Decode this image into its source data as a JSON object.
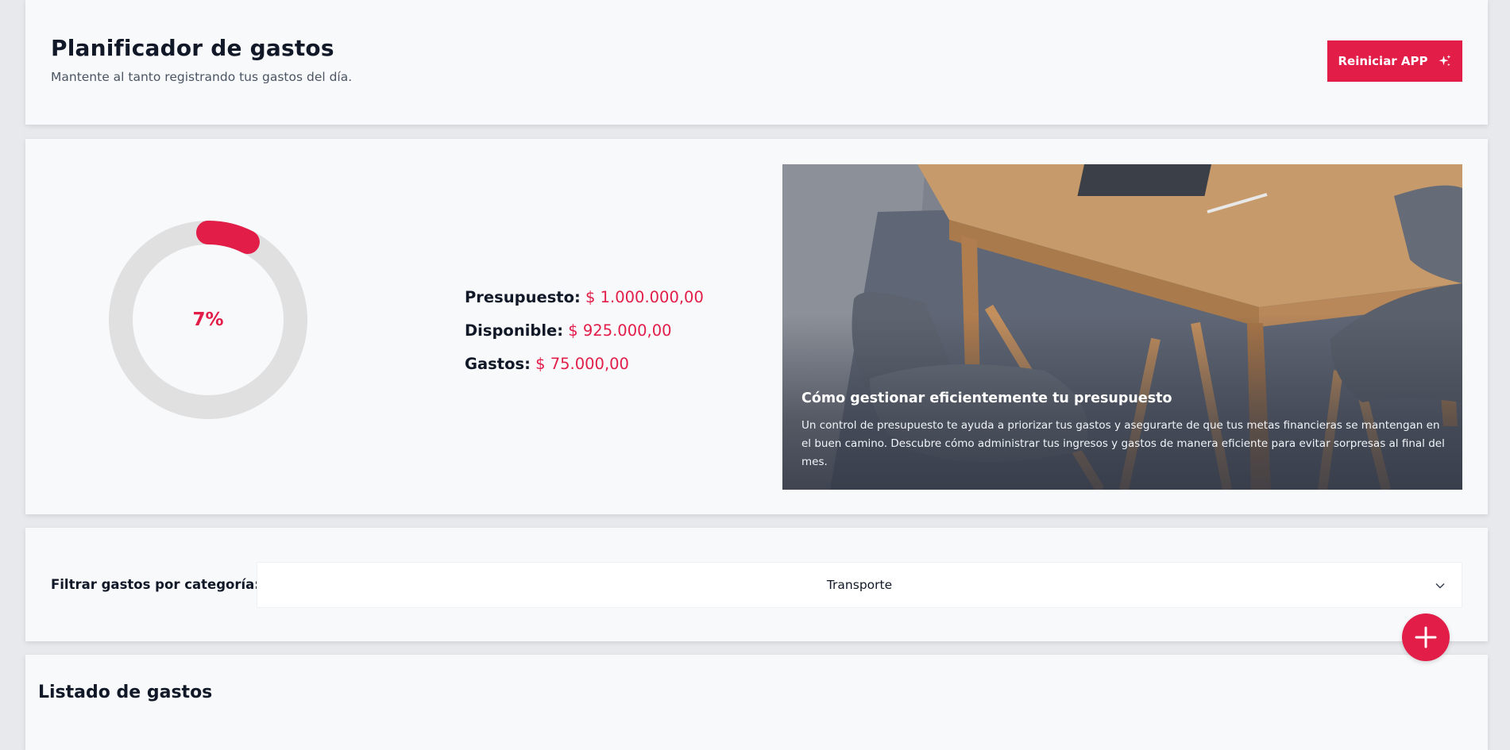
{
  "header": {
    "title": "Planificador de gastos",
    "subtitle": "Mantente al tanto registrando tus gastos del día.",
    "reset_button": "Reiniciar APP",
    "reset_icon": "sparkles-icon"
  },
  "budget": {
    "percent_label": "7%",
    "percent_spent": 0.075,
    "rows": [
      {
        "label": "Presupuesto:",
        "value": "$ 1.000.000,00"
      },
      {
        "label": "Disponible:",
        "value": "$ 925.000,00"
      },
      {
        "label": "Gastos:",
        "value": "$ 75.000,00"
      }
    ]
  },
  "promo": {
    "title": "Cómo gestionar eficientemente tu presupuesto",
    "text": "Un control de presupuesto te ayuda a priorizar tus gastos y asegurarte de que tus metas financieras se mantengan en el buen camino. Descubre cómo administrar tus ingresos y gastos de manera eficiente para evitar sorpresas al final del mes."
  },
  "filter": {
    "label": "Filtrar gastos por categoría:",
    "selected": "Transporte"
  },
  "list": {
    "title": "Listado de gastos"
  },
  "colors": {
    "accent": "#e11d48",
    "track": "#e0e0e0"
  }
}
